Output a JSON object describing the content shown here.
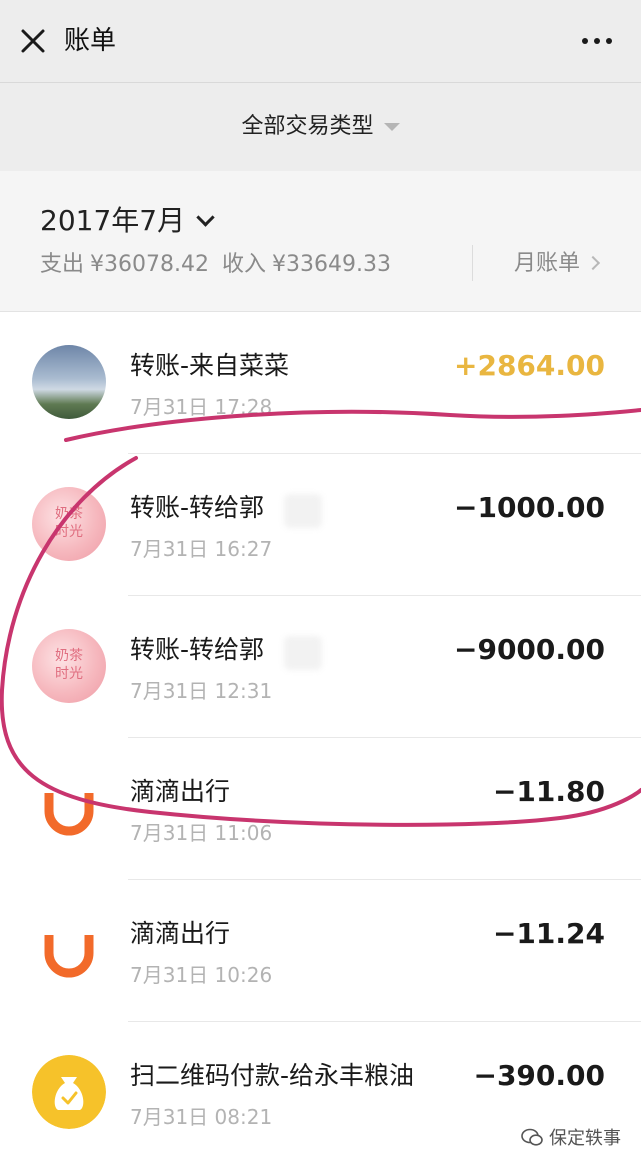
{
  "header": {
    "title": "账单",
    "close_icon": "close-icon",
    "more_icon": "more-icon"
  },
  "filter": {
    "label": "全部交易类型"
  },
  "summary": {
    "month": "2017年7月",
    "expense_label": "支出",
    "expense_value": "¥36078.42",
    "income_label": "收入",
    "income_value": "¥33649.33",
    "monthly_bill_label": "月账单"
  },
  "transactions": [
    {
      "title": "转账-来自菜菜",
      "time": "7月31日 17:28",
      "amount": "+2864.00",
      "type": "income",
      "icon": "sky-avatar"
    },
    {
      "title": "转账-转给郭",
      "time": "7月31日 16:27",
      "amount": "−1000.00",
      "type": "expense",
      "icon": "pink-avatar",
      "avatar_text": "奶茶\n时光"
    },
    {
      "title": "转账-转给郭",
      "time": "7月31日 12:31",
      "amount": "−9000.00",
      "type": "expense",
      "icon": "pink-avatar",
      "avatar_text": "奶茶\n时光"
    },
    {
      "title": "滴滴出行",
      "time": "7月31日 11:06",
      "amount": "−11.80",
      "type": "expense",
      "icon": "didi-icon"
    },
    {
      "title": "滴滴出行",
      "time": "7月31日 10:26",
      "amount": "−11.24",
      "type": "expense",
      "icon": "didi-icon"
    },
    {
      "title": "扫二维码付款-给永丰粮油",
      "time": "7月31日 08:21",
      "amount": "−390.00",
      "type": "expense",
      "icon": "money-bag-icon"
    }
  ],
  "watermark": "保定轶事",
  "colors": {
    "income": "#e9b640",
    "didi_orange": "#f26a2a",
    "money_yellow": "#f6c22a",
    "annotation": "#c8356e"
  }
}
